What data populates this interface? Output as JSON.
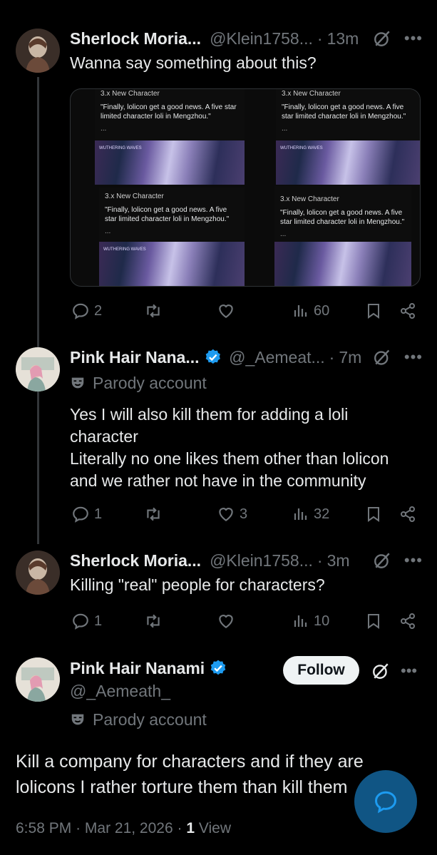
{
  "thread": [
    {
      "name": "Sherlock Moria...",
      "handle": "@Klein1758...",
      "time": "13m",
      "text": "Wanna say something about this?",
      "actions": {
        "replies": "2",
        "reposts": "",
        "likes": "",
        "views": "60"
      }
    },
    {
      "name": "Pink Hair Nana...",
      "handle": "@_Aemeat...",
      "time": "7m",
      "parody": "Parody account",
      "text_lines": [
        "Yes I will also kill them for adding a loli",
        "character",
        "Literally no one likes them other than lolicon",
        "and we rather not have in the community"
      ],
      "actions": {
        "replies": "1",
        "reposts": "",
        "likes": "3",
        "views": "32"
      }
    },
    {
      "name": "Sherlock Moria...",
      "handle": "@Klein1758...",
      "time": "3m",
      "text": "Killing \"real\" people for characters?",
      "actions": {
        "replies": "1",
        "reposts": "",
        "likes": "",
        "views": "10"
      }
    }
  ],
  "media": {
    "title": "3.x New Character",
    "quote": "\"Finally, lolicon get a good news. A five star limited character loli in Mengzhou.\"",
    "ellipsis": "...",
    "logo": "WUTHERING WAVES"
  },
  "main_tweet": {
    "name": "Pink Hair Nanami",
    "handle": "@_Aemeath_",
    "parody": "Parody account",
    "follow_label": "Follow",
    "text_lines": [
      "Kill a company for characters and if they are",
      "lolicons I rather torture them than kill them"
    ],
    "time": "6:58 PM",
    "date": "Mar 21, 2026",
    "views_count": "1",
    "views_label": "View"
  },
  "colors": {
    "background": "#000000",
    "text": "#e7e9ea",
    "muted": "#71767b",
    "verified": "#1d9bf0",
    "follow_bg": "#eff3f4"
  },
  "icons": [
    "reply-icon",
    "repost-icon",
    "like-icon",
    "views-icon",
    "bookmark-icon",
    "share-icon",
    "grok-icon",
    "more-icon",
    "verified-icon",
    "parody-mask-icon",
    "compose-icon"
  ]
}
